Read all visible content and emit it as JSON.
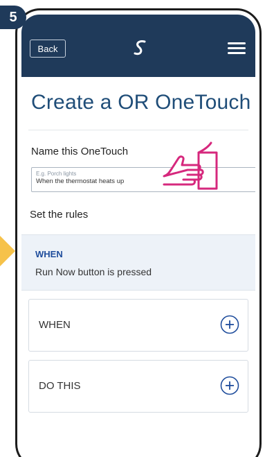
{
  "step": {
    "number": "5"
  },
  "colors": {
    "header_bg": "#1f3a5a",
    "title": "#1f4d78",
    "accent_blue": "#1f4d9c",
    "hand_magenta": "#d6287d",
    "arrow_yellow": "#f6c24a"
  },
  "header": {
    "back_label": "Back",
    "logo_icon": "s-logo-icon",
    "menu_icon": "hamburger-menu-icon"
  },
  "page": {
    "title": "Create a OR OneTouch"
  },
  "name_section": {
    "label": "Name this OneTouch",
    "placeholder": "E.g. Porch lights",
    "value": "When the thermostat heats up"
  },
  "rules": {
    "label": "Set the rules",
    "when_block": {
      "heading": "WHEN",
      "text": "Run Now button is pressed"
    },
    "cards": [
      {
        "label": "WHEN",
        "icon": "plus-circle-icon"
      },
      {
        "label": "DO THIS",
        "icon": "plus-circle-icon"
      }
    ]
  }
}
